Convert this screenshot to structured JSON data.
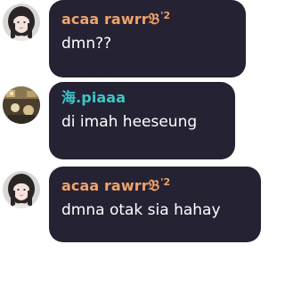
{
  "colors": {
    "bubble_background": "#252234",
    "sender_orange": "#f0a36b",
    "sender_teal": "#3dc6c6",
    "message_text": "#ffffff",
    "page_background": "#ffffff"
  },
  "messages": [
    {
      "sender": "acaa rawrr",
      "badge_glyph": "𝔅",
      "badge_text": "'2",
      "text": "dmn??",
      "avatar": "profile-photo-girl"
    },
    {
      "sender": "海.piaaa",
      "text": "di imah heeseung",
      "avatar": "profile-photo-room"
    },
    {
      "sender": "acaa rawrr",
      "badge_glyph": "𝔅",
      "badge_text": "'2",
      "text": "dmna otak sia hahay",
      "avatar": "profile-photo-girl"
    }
  ]
}
